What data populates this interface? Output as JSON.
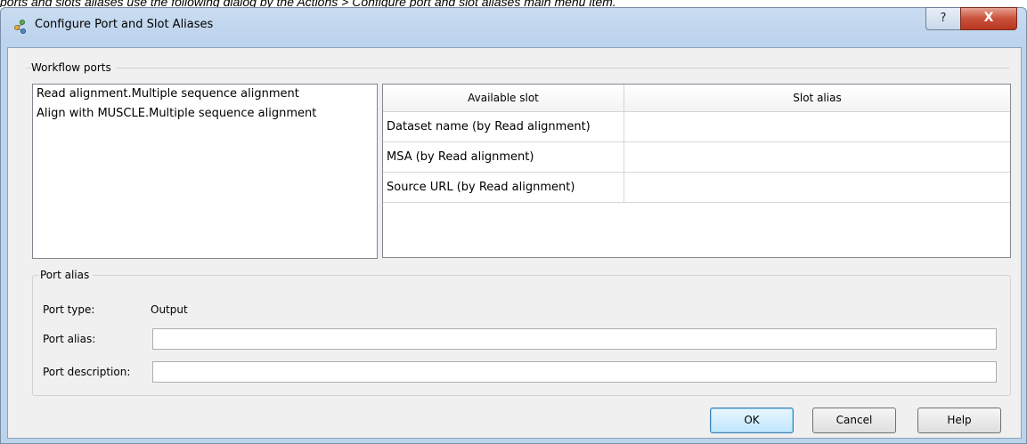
{
  "caption": "ports and slots aliases use the following dialog by the Actions > Configure port and slot aliases main menu item.",
  "window": {
    "title": "Configure Port and Slot Aliases",
    "help_glyph": "?",
    "close_glyph": "X"
  },
  "workflow_ports": {
    "group_label": "Workflow ports",
    "items": [
      "Read alignment.Multiple sequence alignment",
      "Align with MUSCLE.Multiple sequence alignment"
    ]
  },
  "slot_table": {
    "columns": [
      "Available slot",
      "Slot alias"
    ],
    "rows": [
      {
        "slot": "Dataset name (by Read alignment)",
        "alias": ""
      },
      {
        "slot": "MSA (by Read alignment)",
        "alias": ""
      },
      {
        "slot": "Source URL (by Read alignment)",
        "alias": ""
      }
    ]
  },
  "port_alias": {
    "group_label": "Port alias",
    "port_type_label": "Port type:",
    "port_type_value": "Output",
    "alias_label": "Port alias:",
    "alias_value": "",
    "description_label": "Port description:",
    "description_value": ""
  },
  "buttons": {
    "ok": "OK",
    "cancel": "Cancel",
    "help": "Help"
  },
  "colors": {
    "title_bar": "#bcd3ec",
    "client_bg": "#f0f0f0",
    "close_button": "#c9503a",
    "default_button_border": "#3c7fb1"
  }
}
